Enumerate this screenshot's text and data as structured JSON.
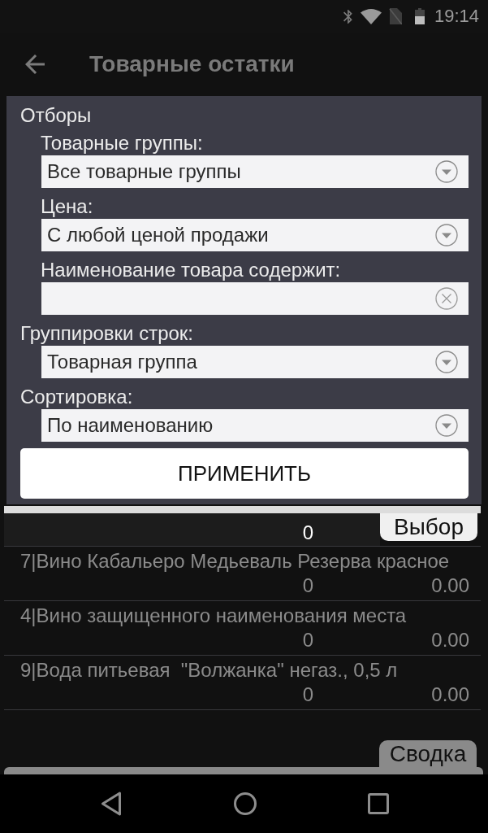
{
  "status_bar": {
    "time": "19:14"
  },
  "app_bar": {
    "title": "Товарные остатки"
  },
  "filter_panel": {
    "sections": [
      {
        "title": "Отборы",
        "fields": [
          {
            "label": "Товарные группы:",
            "kind": "dropdown",
            "value": "Все товарные группы"
          },
          {
            "label": "Цена:",
            "kind": "dropdown",
            "value": "С любой ценой продажи"
          },
          {
            "label": "Наименование товара содержит:",
            "kind": "text"
          }
        ]
      },
      {
        "title": "Группировки строк:",
        "fields": [
          {
            "kind": "dropdown",
            "value": "Товарная группа"
          }
        ]
      },
      {
        "title": "Сортировка:",
        "fields": [
          {
            "kind": "dropdown",
            "value": "По наименованию"
          }
        ]
      }
    ],
    "apply_button": "ПРИМЕНИТЬ"
  },
  "list": {
    "rows": [
      {
        "selected": true,
        "column_2": "0"
      },
      {
        "name": "7|Вино Кабальеро Медьеваль Резерва красное",
        "selected": false,
        "column_2": "0",
        "column_3": "0.00"
      },
      {
        "name": "4|Вино защищенного наименования места",
        "selected": false,
        "column_2": "0",
        "column_3": "0.00"
      },
      {
        "name": "9|Вода питьевая  \"Волжанка\" негаз., 0,5 л",
        "selected": false,
        "column_2": "0",
        "column_3": "0.00"
      }
    ]
  },
  "drawers": [
    {
      "label": "Выбор",
      "kind": "top",
      "expanded": true
    },
    {
      "label": "Сводка",
      "kind": "bottom",
      "expanded": false
    }
  ]
}
